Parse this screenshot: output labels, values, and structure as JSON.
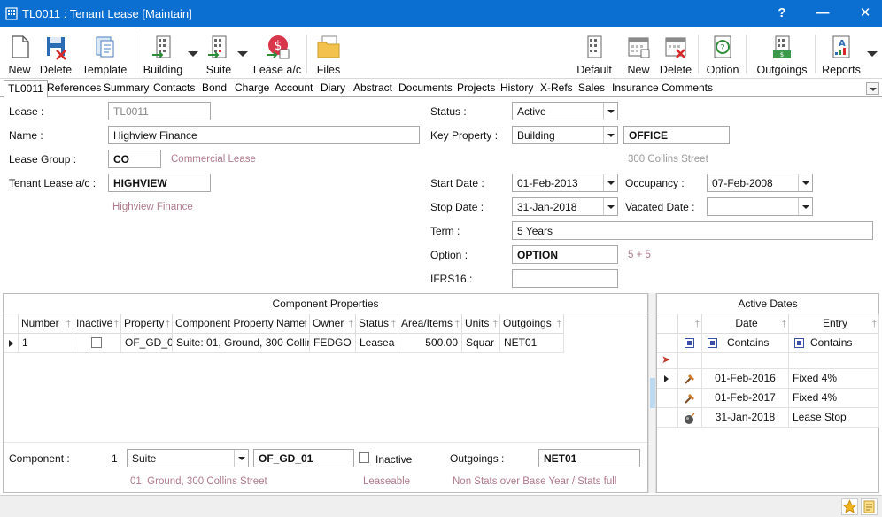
{
  "window": {
    "title": "TL0011 : Tenant Lease [Maintain]",
    "help_label": "?",
    "minimize_label": "—",
    "close_label": "✕"
  },
  "toolbar": {
    "new_label": "New",
    "delete_label": "Delete",
    "template_label": "Template",
    "building_label": "Building",
    "suite_label": "Suite",
    "lease_ac_label": "Lease a/c",
    "files_label": "Files",
    "default_label": "Default",
    "new2_label": "New",
    "delete2_label": "Delete",
    "option_label": "Option",
    "outgoings_label": "Outgoings",
    "reports_label": "Reports"
  },
  "tabs": [
    "TL0011",
    "References",
    "Summary",
    "Contacts",
    "Bond",
    "Charge",
    "Account",
    "Diary",
    "Abstract",
    "Documents",
    "Projects",
    "History",
    "X-Refs",
    "Sales",
    "Insurance",
    "Comments"
  ],
  "form": {
    "lease_label": "Lease :",
    "lease_value": "TL0011",
    "name_label": "Name :",
    "name_value": "Highview Finance",
    "lease_group_label": "Lease Group :",
    "lease_group_value": "CO",
    "lease_group_hint": "Commercial Lease",
    "tenant_ac_label": "Tenant Lease a/c :",
    "tenant_ac_value": "HIGHVIEW",
    "tenant_ac_hint": "Highview Finance",
    "status_label": "Status :",
    "status_value": "Active",
    "key_property_label": "Key Property :",
    "key_property_type": "Building",
    "key_property_value": "OFFICE",
    "key_property_hint": "300 Collins Street",
    "start_date_label": "Start Date :",
    "start_date_value": "01-Feb-2013",
    "stop_date_label": "Stop Date :",
    "stop_date_value": "31-Jan-2018",
    "occupancy_label": "Occupancy :",
    "occupancy_value": "07-Feb-2008",
    "vacated_label": "Vacated Date :",
    "vacated_value": "",
    "term_label": "Term :",
    "term_value": "5 Years",
    "option_label": "Option :",
    "option_value": "OPTION",
    "option_hint": "5 + 5",
    "ifrs_label": "IFRS16 :",
    "ifrs_value": ""
  },
  "components": {
    "title": "Component Properties",
    "columns": [
      "Number",
      "Inactive",
      "Property",
      "Component Property Name",
      "Owner",
      "Status",
      "Area/Items",
      "Units",
      "Outgoings"
    ],
    "rows": [
      {
        "number": "1",
        "inactive": false,
        "property": "OF_GD_0",
        "name": "Suite: 01, Ground, 300 Collin",
        "owner": "FEDGO",
        "status": "Leasea",
        "area": "500.00",
        "units": "Squar",
        "outgoings": "NET01"
      }
    ],
    "component_label": "Component :",
    "component_number": "1",
    "component_type": "Suite",
    "component_code": "OF_GD_01",
    "inactive_label": "Inactive",
    "outgoings_label": "Outgoings :",
    "outgoings_value": "NET01",
    "address_hint": "01, Ground, 300 Collins Street",
    "status_hint": "Leaseable",
    "outgoings_hint": "Non Stats over Base Year / Stats full"
  },
  "active_dates": {
    "title": "Active Dates",
    "columns": [
      "Date",
      "Entry"
    ],
    "filter_date": "Contains",
    "filter_entry": "Contains",
    "rows": [
      {
        "date": "01-Feb-2016",
        "entry": "Fixed 4%",
        "icon": "hammer-icon"
      },
      {
        "date": "01-Feb-2017",
        "entry": "Fixed 4%",
        "icon": "hammer-icon"
      },
      {
        "date": "31-Jan-2018",
        "entry": "Lease Stop",
        "icon": "bomb-icon"
      }
    ]
  },
  "colors": {
    "titlebar": "#0a6fd1",
    "hint": "#b07a8a"
  }
}
